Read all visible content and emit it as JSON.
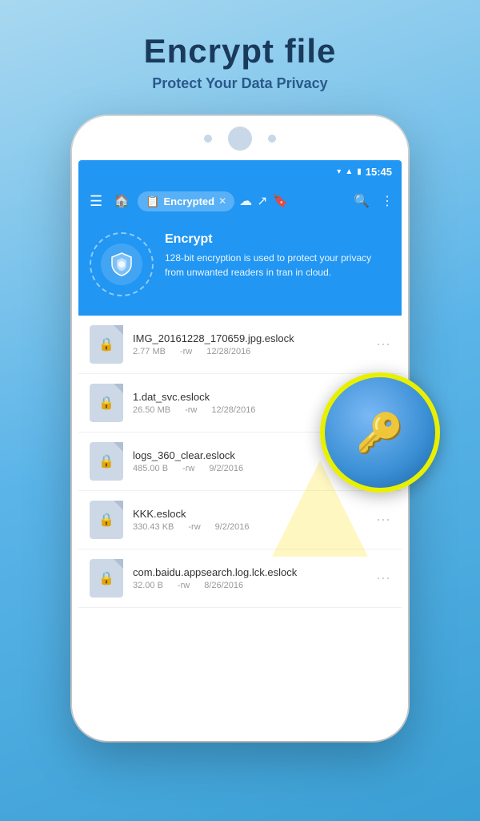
{
  "header": {
    "title": "Encrypt file",
    "subtitle": "Protect Your Data Privacy"
  },
  "status_bar": {
    "time": "15:45"
  },
  "nav": {
    "tab_label": "Encrypted",
    "home_symbol": "⌂",
    "hamburger": "☰",
    "close": "✕"
  },
  "banner": {
    "title": "Encrypt",
    "description": "128-bit encryption is used to protect your privacy from unwanted readers in tran in cloud."
  },
  "files": [
    {
      "name": "IMG_20161228_170659.jpg.eslock",
      "size": "2.77 MB",
      "perms": "-rw",
      "date": "12/28/2016"
    },
    {
      "name": "1.dat_svc.eslock",
      "size": "26.50 MB",
      "perms": "-rw",
      "date": "12/28/2016"
    },
    {
      "name": "logs_360_clear.eslock",
      "size": "485.00 B",
      "perms": "-rw",
      "date": "9/2/2016"
    },
    {
      "name": "KKK.eslock",
      "size": "330.43 KB",
      "perms": "-rw",
      "date": "9/2/2016"
    },
    {
      "name": "com.baidu.appsearch.log.lck.eslock",
      "size": "32.00 B",
      "perms": "-rw",
      "date": "8/26/2016"
    }
  ]
}
